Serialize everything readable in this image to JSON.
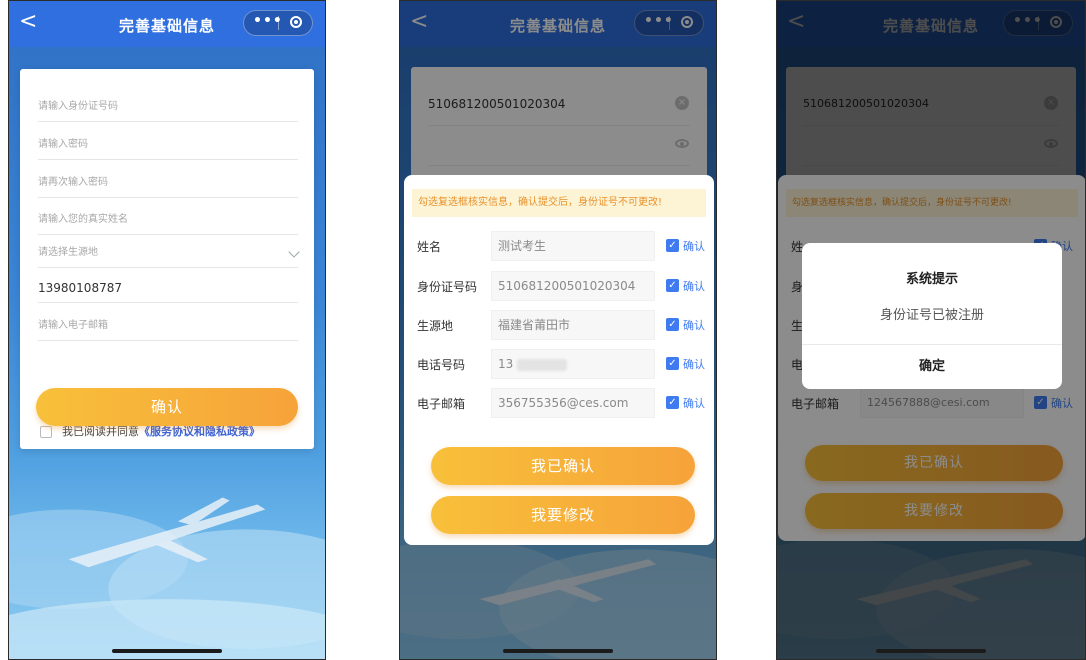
{
  "nav": {
    "back_glyph": "<",
    "title": "完善基础信息",
    "more_glyph": "•••"
  },
  "form": {
    "id_placeholder": "请输入身份证号码",
    "pwd_placeholder": "请输入密码",
    "pwd2_placeholder": "请再次输入密码",
    "name_placeholder": "请输入您的真实姓名",
    "origin_placeholder": "请选择生源地",
    "phone_value": "13980108787",
    "email_placeholder": "请输入电子邮箱",
    "agree_text": "我已阅读并同意",
    "agree_link": "《服务协议和隐私政策》",
    "submit_label": "确认"
  },
  "confirm_sheet": {
    "bg_id_value": "510681200501020304",
    "notice": "勾选复选框核实信息，确认提交后，身份证号不可更改!",
    "rows": [
      {
        "label": "姓名",
        "value": "测试考生",
        "confirm": "确认"
      },
      {
        "label": "身份证号码",
        "value": "510681200501020304",
        "confirm": "确认"
      },
      {
        "label": "生源地",
        "value": "福建省莆田市",
        "confirm": "确认"
      },
      {
        "label": "电话号码",
        "value": "13",
        "confirm": "确认"
      },
      {
        "label": "电子邮箱",
        "value": "356755356@ces.com",
        "confirm": "确认"
      }
    ],
    "confirmed_label": "我已确认",
    "modify_label": "我要修改"
  },
  "panel3": {
    "bg_id_value": "510681200501020304",
    "notice": "勾选复选框核实信息，确认提交后，身份证号不可更改!",
    "row_labels": [
      "姓",
      "身",
      "生",
      "电",
      "电子邮箱"
    ],
    "email_value": "124567888@cesi.com",
    "confirm": "确认",
    "confirmed_label": "我已确认",
    "modify_label": "我要修改"
  },
  "dialog": {
    "title": "系统提示",
    "message": "身份证号已被注册",
    "ok_label": "确定"
  }
}
